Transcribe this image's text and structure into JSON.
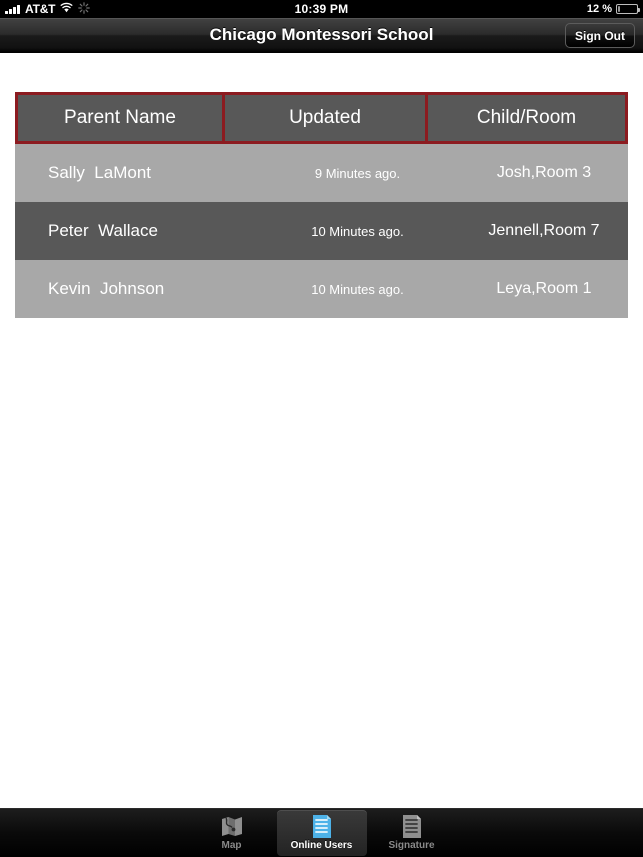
{
  "status_bar": {
    "carrier": "AT&T",
    "signal_icon": "signal-bars-icon",
    "wifi_icon": "wifi-icon",
    "activity_icon": "activity-spinner-icon",
    "time": "10:39 PM",
    "battery_percent": "12 %",
    "battery_icon": "battery-icon"
  },
  "navbar": {
    "title": "Chicago Montessori School",
    "sign_out_label": "Sign Out"
  },
  "table": {
    "columns": [
      "Parent Name",
      "Updated",
      "Child/Room"
    ],
    "rows": [
      {
        "parent_name": "Sally  LaMont",
        "updated": "9 Minutes ago.",
        "child_room": "Josh,Room 3"
      },
      {
        "parent_name": "Peter  Wallace",
        "updated": "10 Minutes ago.",
        "child_room": "Jennell,Room 7"
      },
      {
        "parent_name": "Kevin  Johnson",
        "updated": "10 Minutes ago.",
        "child_room": "Leya,Room 1"
      }
    ]
  },
  "tabbar": {
    "tabs": [
      {
        "label": "Map",
        "icon": "map-icon",
        "selected": false
      },
      {
        "label": "Online Users",
        "icon": "document-list-icon",
        "selected": true
      },
      {
        "label": "Signature",
        "icon": "signature-page-icon",
        "selected": false
      }
    ]
  },
  "colors": {
    "header_border_red": "#8c1b20",
    "header_cell_gray": "#585858",
    "row_light_gray": "#a8a8a8",
    "row_dark_gray": "#585858",
    "selected_tab_blue": "#4db2e8"
  }
}
